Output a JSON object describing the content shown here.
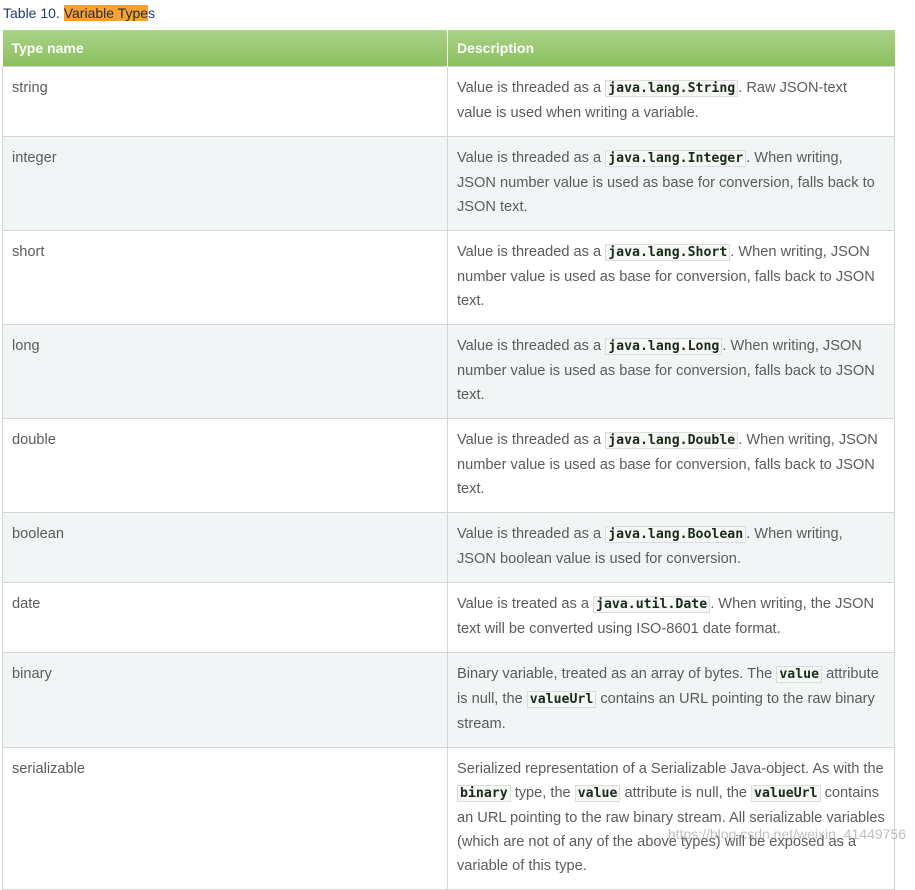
{
  "caption": {
    "prefix": "Table 10. ",
    "highlight": "Variable Type",
    "suffix": "s"
  },
  "table": {
    "headers": [
      "Type name",
      "Description"
    ],
    "rows": [
      {
        "name": "string",
        "desc": [
          {
            "t": "Value is threaded as a "
          },
          {
            "c": "java.lang.String"
          },
          {
            "t": ". Raw JSON-text value is used when writing a variable."
          }
        ]
      },
      {
        "name": "integer",
        "desc": [
          {
            "t": "Value is threaded as a "
          },
          {
            "c": "java.lang.Integer"
          },
          {
            "t": ". When writing, JSON number value is used as base for conversion, falls back to JSON text."
          }
        ]
      },
      {
        "name": "short",
        "desc": [
          {
            "t": "Value is threaded as a "
          },
          {
            "c": "java.lang.Short"
          },
          {
            "t": ". When writing, JSON number value is used as base for conversion, falls back to JSON text."
          }
        ]
      },
      {
        "name": "long",
        "desc": [
          {
            "t": "Value is threaded as a "
          },
          {
            "c": "java.lang.Long"
          },
          {
            "t": ". When writing, JSON number value is used as base for conversion, falls back to JSON text."
          }
        ]
      },
      {
        "name": "double",
        "desc": [
          {
            "t": "Value is threaded as a "
          },
          {
            "c": "java.lang.Double"
          },
          {
            "t": ". When writing, JSON number value is used as base for conversion, falls back to JSON text."
          }
        ]
      },
      {
        "name": "boolean",
        "desc": [
          {
            "t": "Value is threaded as a "
          },
          {
            "c": "java.lang.Boolean"
          },
          {
            "t": ". When writing, JSON boolean value is used for conversion."
          }
        ]
      },
      {
        "name": "date",
        "desc": [
          {
            "t": "Value is treated as a "
          },
          {
            "c": "java.util.Date"
          },
          {
            "t": ". When writing, the JSON text will be converted using ISO-8601 date format."
          }
        ]
      },
      {
        "name": "binary",
        "desc": [
          {
            "t": "Binary variable, treated as an array of bytes. The "
          },
          {
            "c": "value"
          },
          {
            "t": " attribute is null, the "
          },
          {
            "c": "valueUrl"
          },
          {
            "t": " contains an URL pointing to the raw binary stream."
          }
        ]
      },
      {
        "name": "serializable",
        "desc": [
          {
            "t": "Serialized representation of a Serializable Java-object. As with the "
          },
          {
            "c": "binary"
          },
          {
            "t": " type, the "
          },
          {
            "c": "value"
          },
          {
            "t": " attribute is null, the "
          },
          {
            "c": "valueUrl"
          },
          {
            "t": " contains an URL pointing to the raw binary stream. All serializable variables (which are not of any of the above types) will be exposed as a variable of this type."
          }
        ]
      }
    ]
  },
  "watermark": "https://blog.csdn.net/weixin_41449756"
}
